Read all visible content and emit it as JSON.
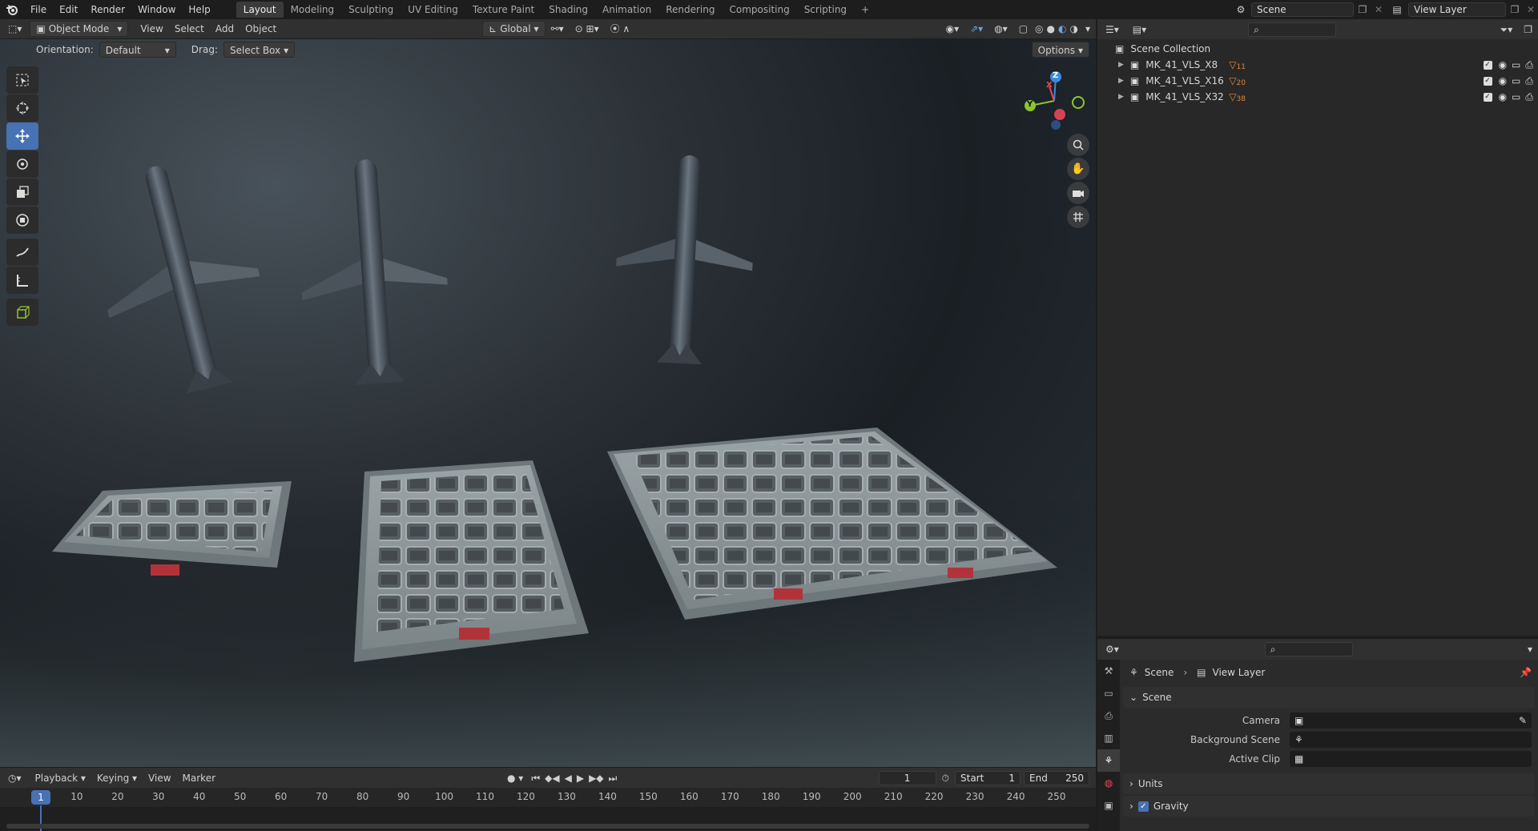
{
  "topbar": {
    "menus": [
      "File",
      "Edit",
      "Render",
      "Window",
      "Help"
    ],
    "workspaces": [
      "Layout",
      "Modeling",
      "Sculpting",
      "UV Editing",
      "Texture Paint",
      "Shading",
      "Animation",
      "Rendering",
      "Compositing",
      "Scripting"
    ],
    "active_workspace": "Layout",
    "add_tab": "+",
    "scene": "Scene",
    "view_layer": "View Layer"
  },
  "viewport": {
    "mode": "Object Mode",
    "menus": [
      "View",
      "Select",
      "Add",
      "Object"
    ],
    "transform_orientation": "Global",
    "orientation_label": "Orientation:",
    "orientation_value": "Default",
    "drag_label": "Drag:",
    "drag_value": "Select Box",
    "options": "Options",
    "gizmo": {
      "x": "X",
      "y": "Y",
      "z": "Z"
    },
    "colors": {
      "x": "#e8475a",
      "y": "#8ec434",
      "z": "#3d8ae0"
    }
  },
  "toolbar": {
    "tools": [
      "select-box-icon",
      "cursor-icon",
      "move-icon",
      "rotate-icon",
      "scale-icon",
      "transform-icon",
      "annotate-icon",
      "measure-icon",
      "add-cube-icon"
    ],
    "active": "move-icon"
  },
  "timeline": {
    "menus": [
      "Playback",
      "Keying",
      "View",
      "Marker"
    ],
    "current_frame": "1",
    "start_label": "Start",
    "start": "1",
    "end_label": "End",
    "end": "250",
    "ticks": [
      "1",
      "10",
      "20",
      "30",
      "40",
      "50",
      "60",
      "70",
      "80",
      "90",
      "100",
      "110",
      "120",
      "130",
      "140",
      "150",
      "160",
      "170",
      "180",
      "190",
      "200",
      "210",
      "220",
      "230",
      "240",
      "250"
    ]
  },
  "outliner": {
    "root": "Scene Collection",
    "items": [
      {
        "name": "MK_41_VLS_X8",
        "count": "11"
      },
      {
        "name": "MK_41_VLS_X16",
        "count": "20"
      },
      {
        "name": "MK_41_VLS_X32",
        "count": "38"
      }
    ]
  },
  "properties": {
    "breadcrumb": [
      "Scene",
      "View Layer"
    ],
    "panel_scene": "Scene",
    "fields": [
      {
        "label": "Camera",
        "value": ""
      },
      {
        "label": "Background Scene",
        "value": ""
      },
      {
        "label": "Active Clip",
        "value": ""
      }
    ],
    "panel_units": "Units",
    "panel_gravity": "Gravity",
    "gravity_enabled": true
  },
  "accent": "#4772b3"
}
